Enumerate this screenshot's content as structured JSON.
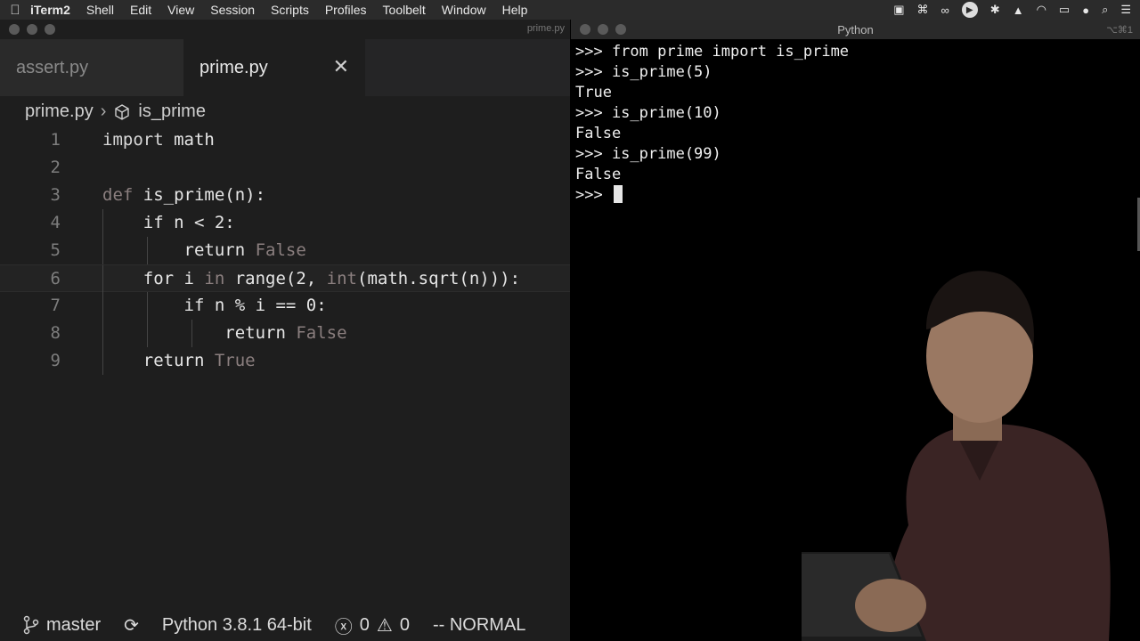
{
  "menubar": {
    "app_name": "iTerm2",
    "items": [
      "Shell",
      "Edit",
      "View",
      "Session",
      "Scripts",
      "Profiles",
      "Toolbelt",
      "Window",
      "Help"
    ]
  },
  "editor": {
    "window_title": "prime.py",
    "tabs": [
      {
        "label": "assert.py",
        "active": false
      },
      {
        "label": "prime.py",
        "active": true
      }
    ],
    "breadcrumb": {
      "file": "prime.py",
      "symbol": "is_prime"
    },
    "code_lines": [
      {
        "n": "1",
        "text": "import math"
      },
      {
        "n": "2",
        "text": ""
      },
      {
        "n": "3",
        "text": "def is_prime(n):"
      },
      {
        "n": "4",
        "text": "    if n < 2:"
      },
      {
        "n": "5",
        "text": "        return False"
      },
      {
        "n": "6",
        "text": "    for i in range(2, int(math.sqrt(n))):"
      },
      {
        "n": "7",
        "text": "        if n % i == 0:"
      },
      {
        "n": "8",
        "text": "            return False"
      },
      {
        "n": "9",
        "text": "    return True"
      }
    ],
    "status": {
      "branch": "master",
      "interpreter": "Python 3.8.1 64-bit",
      "errors": "0",
      "warnings": "0",
      "mode": "-- NORMAL"
    }
  },
  "terminal": {
    "window_title": "Python",
    "shortcut": "⌥⌘1",
    "lines": [
      ">>> from prime import is_prime",
      ">>> is_prime(5)",
      "True",
      ">>> is_prime(10)",
      "False",
      ">>> is_prime(99)",
      "False"
    ],
    "prompt": ">>> "
  },
  "icons": [
    "apple-icon",
    "terminal-icon",
    "command-icon",
    "glasses-icon",
    "play-icon",
    "bluetooth-icon",
    "airdrop-icon",
    "wifi-icon",
    "battery-icon",
    "user-icon",
    "search-icon",
    "list-icon",
    "branch-icon",
    "sync-icon",
    "error-icon",
    "warning-icon",
    "cube-icon",
    "close-icon"
  ]
}
